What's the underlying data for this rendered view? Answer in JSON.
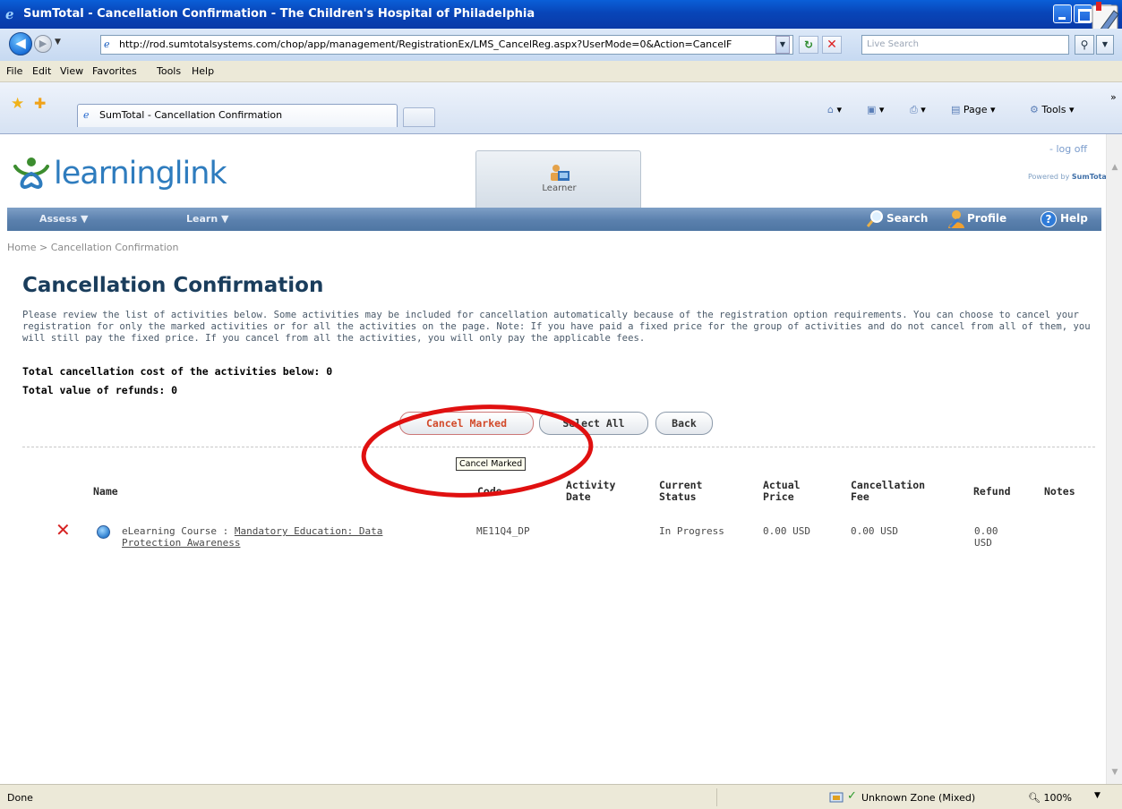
{
  "window": {
    "title": "SumTotal - Cancellation Confirmation - The Children's Hospital of Philadelphia"
  },
  "address_bar": {
    "url": "http://rod.sumtotalsystems.com/chop/app/management/RegistrationEx/LMS_CancelReg.aspx?UserMode=0&Action=CancelF",
    "search_placeholder": "Live Search"
  },
  "menu": [
    "File",
    "Edit",
    "View",
    "Favorites",
    "Tools",
    "Help"
  ],
  "tabs": [
    {
      "label": "SumTotal - Cancellation Confirmation",
      "active": true
    }
  ],
  "command_bar": {
    "page_label": "Page",
    "tools_label": "Tools"
  },
  "site": {
    "logo_text": "learninglink",
    "learner_tab_label": "Learner",
    "log_off": "- log off",
    "powered_prefix": "Powered by",
    "powered_brand": "SumTotal",
    "nav": {
      "assess": "Assess ▼",
      "learn": "Learn ▼",
      "search": "Search",
      "profile": "Profile",
      "help": "Help"
    }
  },
  "breadcrumb": "Home > Cancellation Confirmation",
  "page_title": "Cancellation Confirmation",
  "intro_text": "Please review the list of activities below. Some activities may be included for cancellation automatically because of the registration option requirements. You can choose to cancel your registration for only the marked activities or for all the activities on the page. Note: If you have paid a fixed price for the group of activities and do not cancel from all of them, you will still pay the fixed price. If you cancel from all the activities, you will only pay the applicable fees.",
  "totals": {
    "cancellation_cost": "Total cancellation cost of the activities below: 0",
    "refunds": "Total value of refunds: 0"
  },
  "buttons": {
    "cancel_marked": "Cancel Marked",
    "select_all": "Select All",
    "back": "Back"
  },
  "tooltip": "Cancel Marked",
  "table": {
    "headers": {
      "name": "Name",
      "code": "Code",
      "activity_date_1": "Activity",
      "activity_date_2": "Date",
      "current_status_1": "Current",
      "current_status_2": "Status",
      "actual_price_1": "Actual",
      "actual_price_2": "Price",
      "cancellation_fee_1": "Cancellation",
      "cancellation_fee_2": "Fee",
      "refund": "Refund",
      "notes": "Notes"
    },
    "rows": [
      {
        "type_prefix": "eLearning Course : ",
        "name_line1": "Mandatory Education: Data",
        "name_line2": "Protection Awareness",
        "code": "ME11Q4_DP",
        "activity_date": "",
        "status": "In Progress",
        "actual_price": "0.00 USD",
        "cancellation_fee": "0.00 USD",
        "refund_line1": "0.00",
        "refund_line2": "USD",
        "notes": ""
      }
    ]
  },
  "status_bar": {
    "left": "Done",
    "zone": "Unknown Zone (Mixed)",
    "zoom": "100%"
  },
  "colors": {
    "title_bar": "#0845b8",
    "nav_bar": "#5a80ad",
    "page_title": "#1a3d5c",
    "annotation_circle": "#e01010",
    "cancel_button_text": "#d24a2a"
  }
}
